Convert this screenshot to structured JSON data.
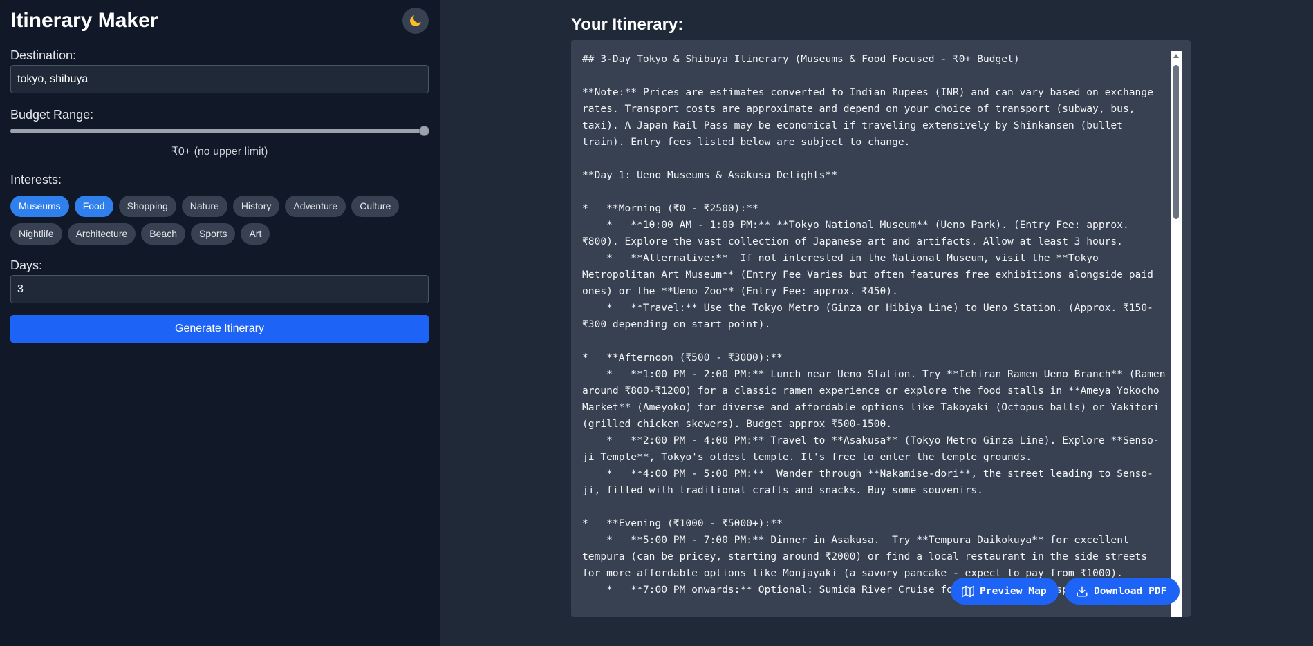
{
  "app_title": "Itinerary Maker",
  "theme_toggle": {
    "icon": "moon-icon"
  },
  "destination": {
    "label": "Destination:",
    "value": "tokyo, shibuya"
  },
  "budget": {
    "label": "Budget Range:",
    "display": "₹0+ (no upper limit)",
    "level": 1.0
  },
  "interests": {
    "label": "Interests:",
    "options": [
      {
        "label": "Museums",
        "selected": true
      },
      {
        "label": "Food",
        "selected": true
      },
      {
        "label": "Shopping",
        "selected": false
      },
      {
        "label": "Nature",
        "selected": false
      },
      {
        "label": "History",
        "selected": false
      },
      {
        "label": "Adventure",
        "selected": false
      },
      {
        "label": "Culture",
        "selected": false
      },
      {
        "label": "Nightlife",
        "selected": false
      },
      {
        "label": "Architecture",
        "selected": false
      },
      {
        "label": "Beach",
        "selected": false
      },
      {
        "label": "Sports",
        "selected": false
      },
      {
        "label": "Art",
        "selected": false
      }
    ]
  },
  "days": {
    "label": "Days:",
    "value": "3"
  },
  "generate_label": "Generate Itinerary",
  "main": {
    "title": "Your Itinerary:",
    "itinerary_text": "## 3-Day Tokyo & Shibuya Itinerary (Museums & Food Focused - ₹0+ Budget)\n\n**Note:** Prices are estimates converted to Indian Rupees (INR) and can vary based on exchange rates. Transport costs are approximate and depend on your choice of transport (subway, bus, taxi). A Japan Rail Pass may be economical if traveling extensively by Shinkansen (bullet train). Entry fees listed below are subject to change.\n\n**Day 1: Ueno Museums & Asakusa Delights**\n\n*   **Morning (₹0 - ₹2500):**\n    *   **10:00 AM - 1:00 PM:** **Tokyo National Museum** (Ueno Park). (Entry Fee: approx. ₹800). Explore the vast collection of Japanese art and artifacts. Allow at least 3 hours.\n    *   **Alternative:**  If not interested in the National Museum, visit the **Tokyo Metropolitan Art Museum** (Entry Fee Varies but often features free exhibitions alongside paid ones) or the **Ueno Zoo** (Entry Fee: approx. ₹450).\n    *   **Travel:** Use the Tokyo Metro (Ginza or Hibiya Line) to Ueno Station. (Approx. ₹150-₹300 depending on start point).\n\n*   **Afternoon (₹500 - ₹3000):**\n    *   **1:00 PM - 2:00 PM:** Lunch near Ueno Station. Try **Ichiran Ramen Ueno Branch** (Ramen around ₹800-₹1200) for a classic ramen experience or explore the food stalls in **Ameya Yokocho Market** (Ameyoko) for diverse and affordable options like Takoyaki (Octopus balls) or Yakitori (grilled chicken skewers). Budget approx ₹500-1500.\n    *   **2:00 PM - 4:00 PM:** Travel to **Asakusa** (Tokyo Metro Ginza Line). Explore **Senso-ji Temple**, Tokyo's oldest temple. It's free to enter the temple grounds.\n    *   **4:00 PM - 5:00 PM:**  Wander through **Nakamise-dori**, the street leading to Senso-ji, filled with traditional crafts and snacks. Buy some souvenirs.\n\n*   **Evening (₹1000 - ₹5000+):**\n    *   **5:00 PM - 7:00 PM:** Dinner in Asakusa.  Try **Tempura Daikokuya** for excellent tempura (can be pricey, starting around ₹2000) or find a local restaurant in the side streets for more affordable options like Monjayaki (a savory pancake - expect to pay from ₹1000).\n    *   **7:00 PM onwards:** Optional: Sumida River Cruise for a different perspective",
    "actions": {
      "preview_map": "Preview Map",
      "download_pdf": "Download PDF"
    }
  }
}
